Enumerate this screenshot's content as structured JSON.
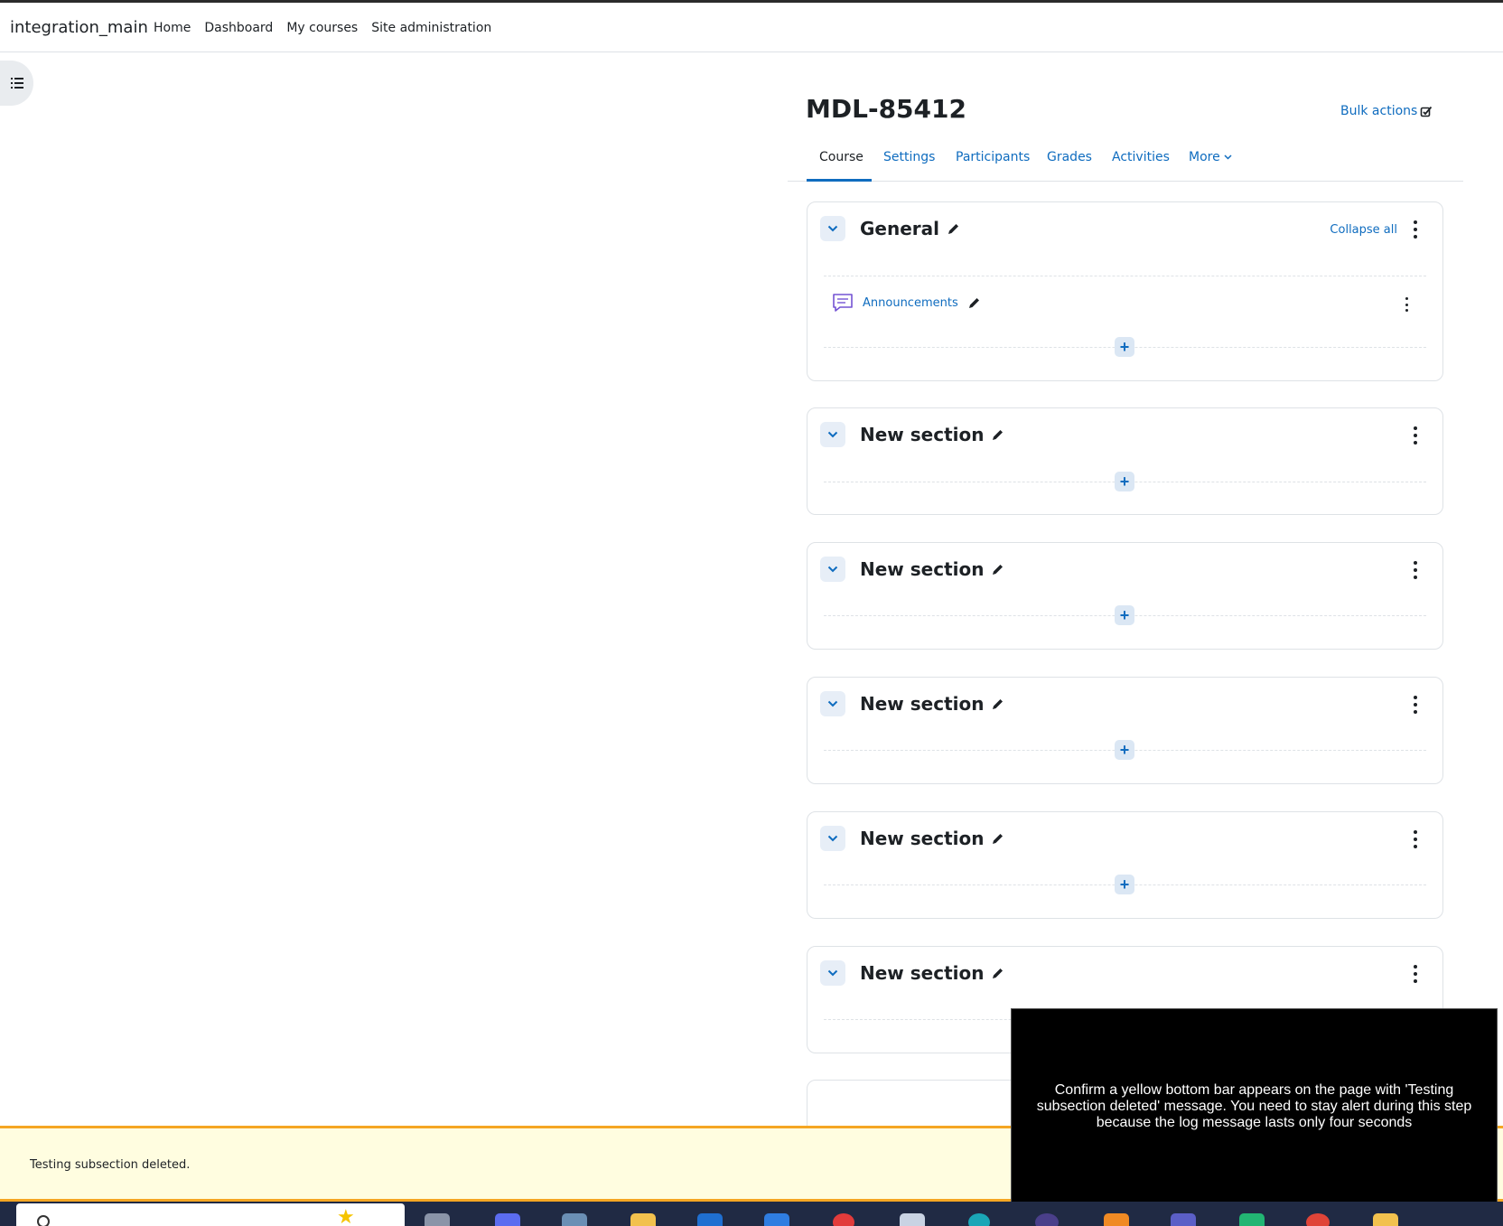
{
  "navbar": {
    "brand": "integration_main",
    "links": [
      "Home",
      "Dashboard",
      "My courses",
      "Site administration"
    ]
  },
  "course": {
    "title": "MDL-85412",
    "bulk_actions": "Bulk actions",
    "tabs": [
      "Course",
      "Settings",
      "Participants",
      "Grades",
      "Activities",
      "More"
    ],
    "active_tab": "Course"
  },
  "sections": [
    {
      "title": "General",
      "collapse_all": "Collapse all",
      "activity": "Announcements"
    },
    {
      "title": "New section"
    },
    {
      "title": "New section"
    },
    {
      "title": "New section"
    },
    {
      "title": "New section"
    },
    {
      "title": "New section"
    }
  ],
  "toast": {
    "message": "Testing subsection deleted."
  },
  "overlay": {
    "text": "Confirm a yellow bottom bar appears on the page with 'Testing subsection deleted' message. You need to stay alert during this step because the log message lasts only four seconds"
  },
  "colors": {
    "link": "#0f6cbf",
    "toast_bg": "#fffde0",
    "toast_border": "#f5a623"
  }
}
